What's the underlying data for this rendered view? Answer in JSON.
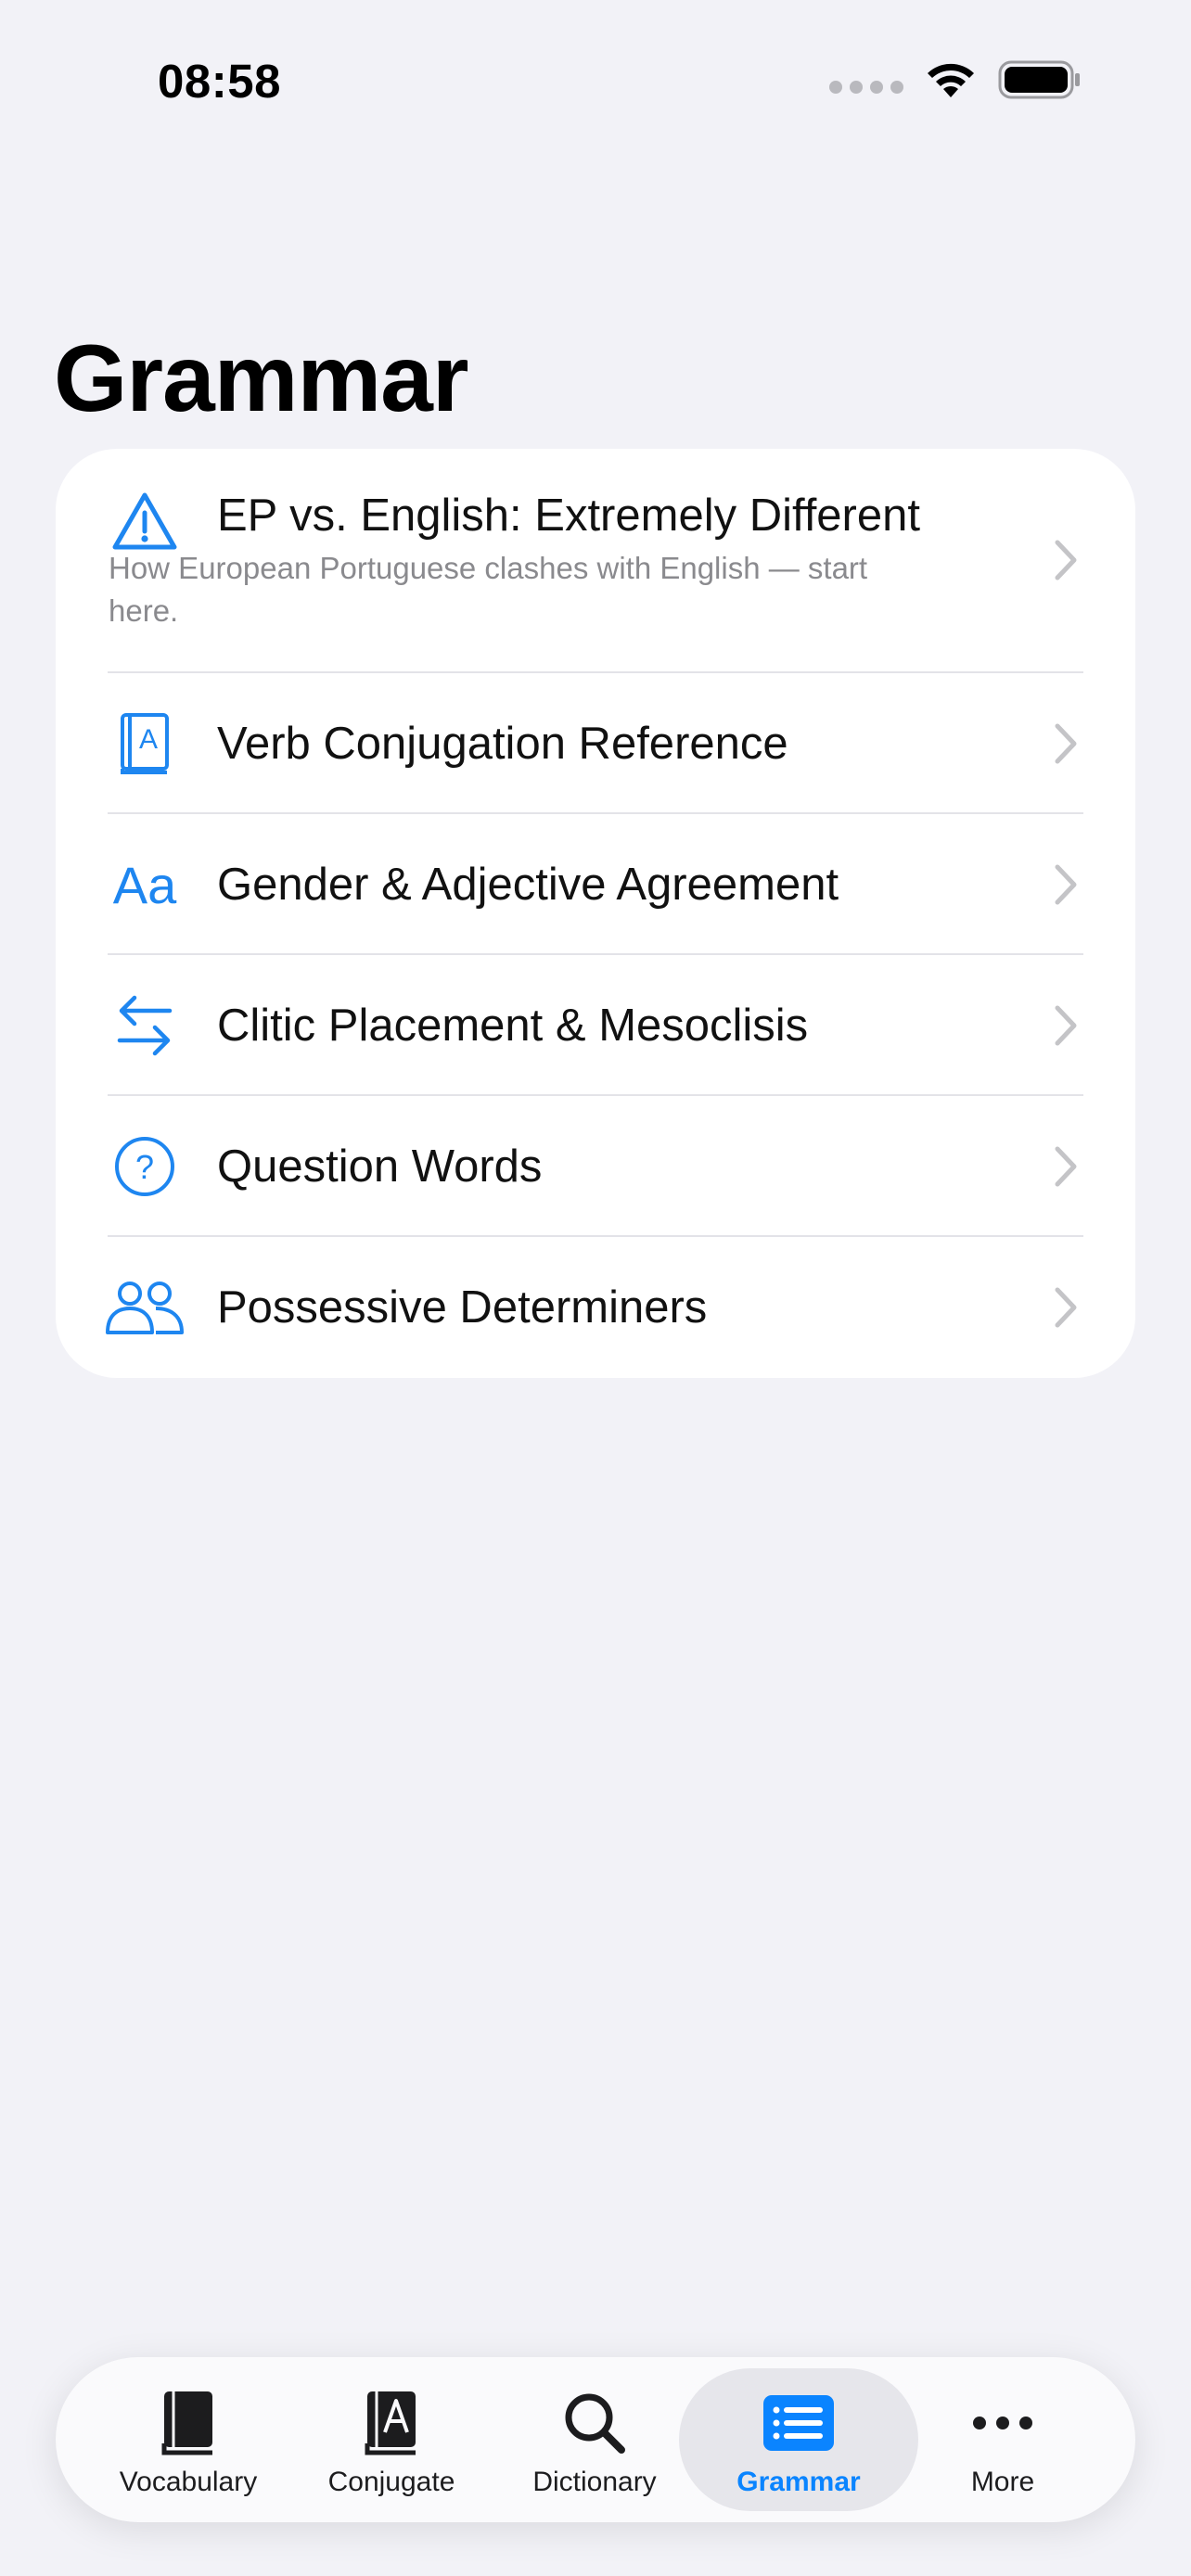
{
  "status": {
    "time": "08:58"
  },
  "header": {
    "title": "Grammar"
  },
  "items": [
    {
      "title": "EP vs. English: Extremely Different",
      "subtitle": "How European Portuguese clashes with English — start here.",
      "icon": "warning-triangle-icon"
    },
    {
      "title": "Verb Conjugation Reference",
      "icon": "book-a-icon"
    },
    {
      "title": "Gender & Adjective Agreement",
      "icon": "textformat-aa-icon",
      "icon_text": "Aa"
    },
    {
      "title": "Clitic Placement & Mesoclisis",
      "icon": "arrows-swap-icon"
    },
    {
      "title": "Question Words",
      "icon": "question-circle-icon",
      "icon_text": "?"
    },
    {
      "title": "Possessive Determiners",
      "icon": "two-people-icon"
    }
  ],
  "tabs": [
    {
      "label": "Vocabulary",
      "icon": "book-icon"
    },
    {
      "label": "Conjugate",
      "icon": "book-a-icon"
    },
    {
      "label": "Dictionary",
      "icon": "magnifier-icon"
    },
    {
      "label": "Grammar",
      "icon": "list-icon",
      "active": true
    },
    {
      "label": "More",
      "icon": "ellipsis-icon"
    }
  ],
  "colors": {
    "accent": "#0A84FF",
    "icon_blue": "#1E86F0",
    "background": "#F2F2F7"
  }
}
